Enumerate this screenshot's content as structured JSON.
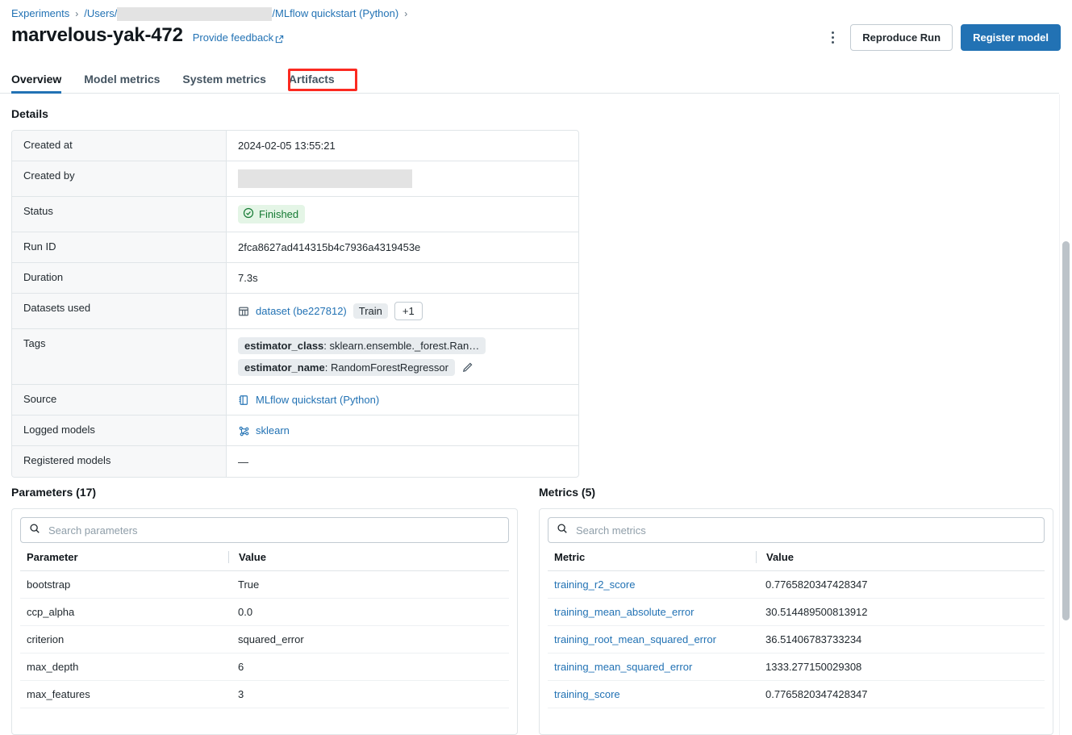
{
  "breadcrumb": {
    "items": [
      {
        "label": "Experiments",
        "type": "link"
      },
      {
        "label": "/Users/",
        "type": "redacted-path",
        "suffix": "/MLflow quickstart (Python)"
      }
    ],
    "separator": "›",
    "users_prefix": "/Users/",
    "path_suffix": "/MLflow quickstart (Python)"
  },
  "header": {
    "run_name": "marvelous-yak-472",
    "feedback_label": "Provide feedback",
    "feedback_icon": "external-link-icon",
    "kebab_icon": "more-vertical-icon",
    "reproduce_label": "Reproduce Run",
    "register_label": "Register model",
    "primary_color": "#2272b4"
  },
  "tabs": [
    {
      "label": "Overview",
      "active": true
    },
    {
      "label": "Model metrics",
      "active": false
    },
    {
      "label": "System metrics",
      "active": false
    },
    {
      "label": "Artifacts",
      "active": false,
      "highlighted": true
    }
  ],
  "highlight_color": "#fb2a21",
  "details": {
    "title": "Details",
    "rows": [
      {
        "key": "Created at",
        "type": "text",
        "value": "2024-02-05 13:55:21"
      },
      {
        "key": "Created by",
        "type": "redacted",
        "value": ""
      },
      {
        "key": "Status",
        "type": "status",
        "value": "Finished",
        "icon": "check-circle-icon"
      },
      {
        "key": "Run ID",
        "type": "text",
        "value": "2fca8627ad414315b4c7936a4319453e"
      },
      {
        "key": "Duration",
        "type": "text",
        "value": "7.3s"
      },
      {
        "key": "Datasets used",
        "type": "datasets",
        "dataset_icon": "table-icon",
        "dataset_label": "dataset (be227812)",
        "dataset_tag": "Train",
        "more_label": "+1"
      },
      {
        "key": "Tags",
        "type": "tags",
        "tags": [
          {
            "name": "estimator_class",
            "value": "sklearn.ensemble._forest.Ran…"
          },
          {
            "name": "estimator_name",
            "value": "RandomForestRegressor"
          }
        ],
        "edit_icon": "pencil-icon"
      },
      {
        "key": "Source",
        "type": "source",
        "icon": "notebook-icon",
        "value": "MLflow quickstart (Python)"
      },
      {
        "key": "Logged models",
        "type": "model",
        "icon": "model-graph-icon",
        "value": "sklearn"
      },
      {
        "key": "Registered models",
        "type": "empty",
        "value": "—"
      }
    ]
  },
  "parameters": {
    "title": "Parameters (17)",
    "search_placeholder": "Search parameters",
    "search_value": "",
    "search_icon": "search-icon",
    "columns": [
      "Parameter",
      "Value"
    ],
    "rows": [
      {
        "name": "bootstrap",
        "value": "True"
      },
      {
        "name": "ccp_alpha",
        "value": "0.0"
      },
      {
        "name": "criterion",
        "value": "squared_error"
      },
      {
        "name": "max_depth",
        "value": "6"
      },
      {
        "name": "max_features",
        "value": "3"
      }
    ]
  },
  "metrics": {
    "title": "Metrics (5)",
    "search_placeholder": "Search metrics",
    "search_value": "",
    "search_icon": "search-icon",
    "columns": [
      "Metric",
      "Value"
    ],
    "rows": [
      {
        "name": "training_r2_score",
        "value": "0.7765820347428347"
      },
      {
        "name": "training_mean_absolute_error",
        "value": "30.514489500813912"
      },
      {
        "name": "training_root_mean_squared_error",
        "value": "36.51406783733234"
      },
      {
        "name": "training_mean_squared_error",
        "value": "1333.277150029308"
      },
      {
        "name": "training_score",
        "value": "0.7765820347428347"
      }
    ]
  },
  "scrollbar": {
    "name": "page-scrollbar"
  }
}
